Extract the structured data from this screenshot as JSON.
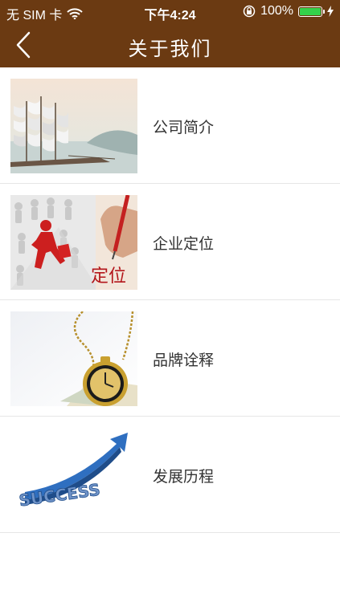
{
  "status_bar": {
    "carrier": "无 SIM 卡",
    "time": "下午4:24",
    "battery": "100%"
  },
  "nav": {
    "title": "关于我们"
  },
  "menu": [
    {
      "label": "公司简介",
      "thumb_icon": "sailing-ship-image"
    },
    {
      "label": "企业定位",
      "thumb_icon": "running-figure-image",
      "thumb_text": "定位"
    },
    {
      "label": "品牌诠释",
      "thumb_icon": "pocket-watch-image"
    },
    {
      "label": "发展历程",
      "thumb_icon": "success-arrow-image",
      "thumb_text": "SUCCESS"
    }
  ],
  "colors": {
    "header": "#6b3a12",
    "divider": "#e6e6e6"
  }
}
